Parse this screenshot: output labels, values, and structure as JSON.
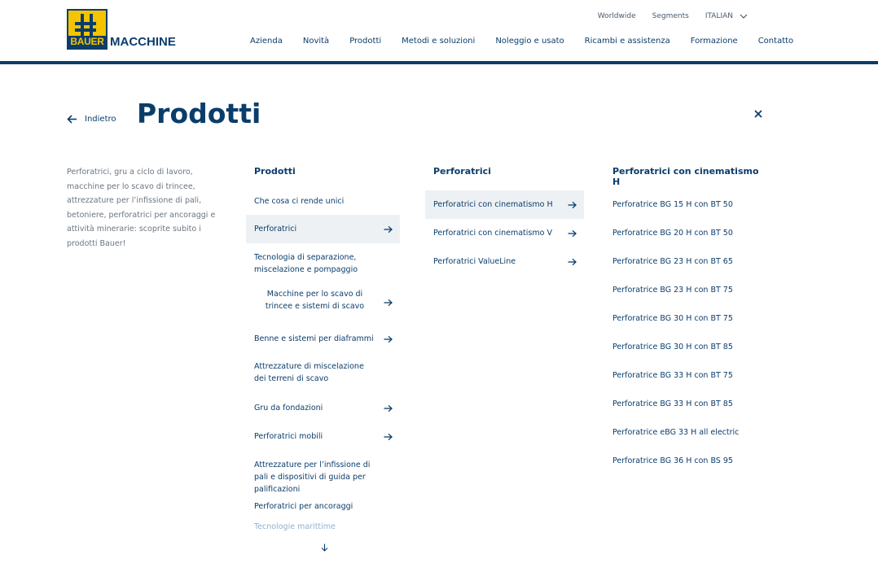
{
  "brand": {
    "logo_label": "BAUER",
    "name": "MACCHINE"
  },
  "util_nav": {
    "worldwide": "Worldwide",
    "segments": "Segments",
    "language": "ITALIAN"
  },
  "main_nav": [
    "Azienda",
    "Novità",
    "Prodotti",
    "Metodi e soluzioni",
    "Noleggio e usato",
    "Ricambi e assistenza",
    "Formazione",
    "Contatto"
  ],
  "page": {
    "back_label": "Indietro",
    "title": "Prodotti"
  },
  "intro_text": "Perforatrici, gru a ciclo di lavoro, macchine per lo scavo di trincee, attrezzature per l’infissione di pali, betoniere, perforatrici per ancoraggi e attività minerarie: scoprite subito i prodotti Bauer!",
  "col1": {
    "heading": "Prodotti",
    "items": [
      "Che cosa ci rende unici",
      "Perforatrici",
      "Tecnologia di separazione, miscelazione e pompaggio",
      "Macchine per lo scavo di trincee e sistemi di scavo",
      "Benne e sistemi per diaframmi",
      "Attrezzature di miscelazione dei terreni di scavo",
      "Gru da fondazioni",
      "Perforatrici mobili",
      "Attrezzature per l’infissione di pali e dispositivi di guida per palificazioni",
      "Perforatrici per ancoraggi",
      "Tecnologie marittime"
    ]
  },
  "col2": {
    "heading": "Perforatrici",
    "items": [
      "Perforatrici con cinematismo H",
      "Perforatrici con cinematismo V",
      "Perforatrici ValueLine"
    ]
  },
  "col3": {
    "heading": "Perforatrici con cinematismo H",
    "items": [
      "Perforatrice BG 15 H con BT 50",
      "Perforatrice BG 20 H con BT 50",
      "Perforatrice BG 23 H con BT 65",
      "Perforatrice BG 23 H con BT 75",
      "Perforatrice BG 30 H con BT 75",
      "Perforatrice BG 30 H con BT 85",
      "Perforatrice BG 33 H con BT 75",
      "Perforatrice BG 33 H con BT 85",
      "Perforatrice eBG 33 H all electric",
      "Perforatrice BG 36 H con BS 95"
    ]
  },
  "colors": {
    "brand_blue": "#0b3d6b",
    "brand_yellow": "#f5c400",
    "active_bg": "#eef1f4"
  }
}
